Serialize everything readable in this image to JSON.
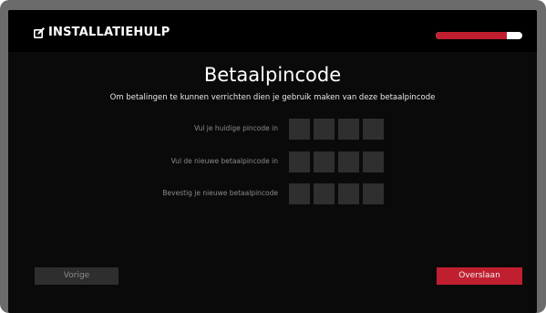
{
  "header": {
    "title": "INSTALLATIEHULP",
    "logo_icon": "edit-square-icon",
    "progress_fraction": 0.82,
    "progress_color": "#c01f2f"
  },
  "main": {
    "title": "Betaalpincode",
    "subtitle": "Om betalingen te kunnen verrichten dien je gebruik maken van deze betaalpincode",
    "rows": [
      {
        "label": "Vul je huidige pincode in",
        "digits": [
          "",
          "",
          "",
          ""
        ]
      },
      {
        "label": "Vul de nieuwe betaalpincode in",
        "digits": [
          "",
          "",
          "",
          ""
        ]
      },
      {
        "label": "Bevestig je nieuwe betaalpincode",
        "digits": [
          "",
          "",
          "",
          ""
        ]
      }
    ]
  },
  "footer": {
    "back_label": "Vorige",
    "skip_label": "Overslaan",
    "accent_color": "#c01f2f"
  }
}
